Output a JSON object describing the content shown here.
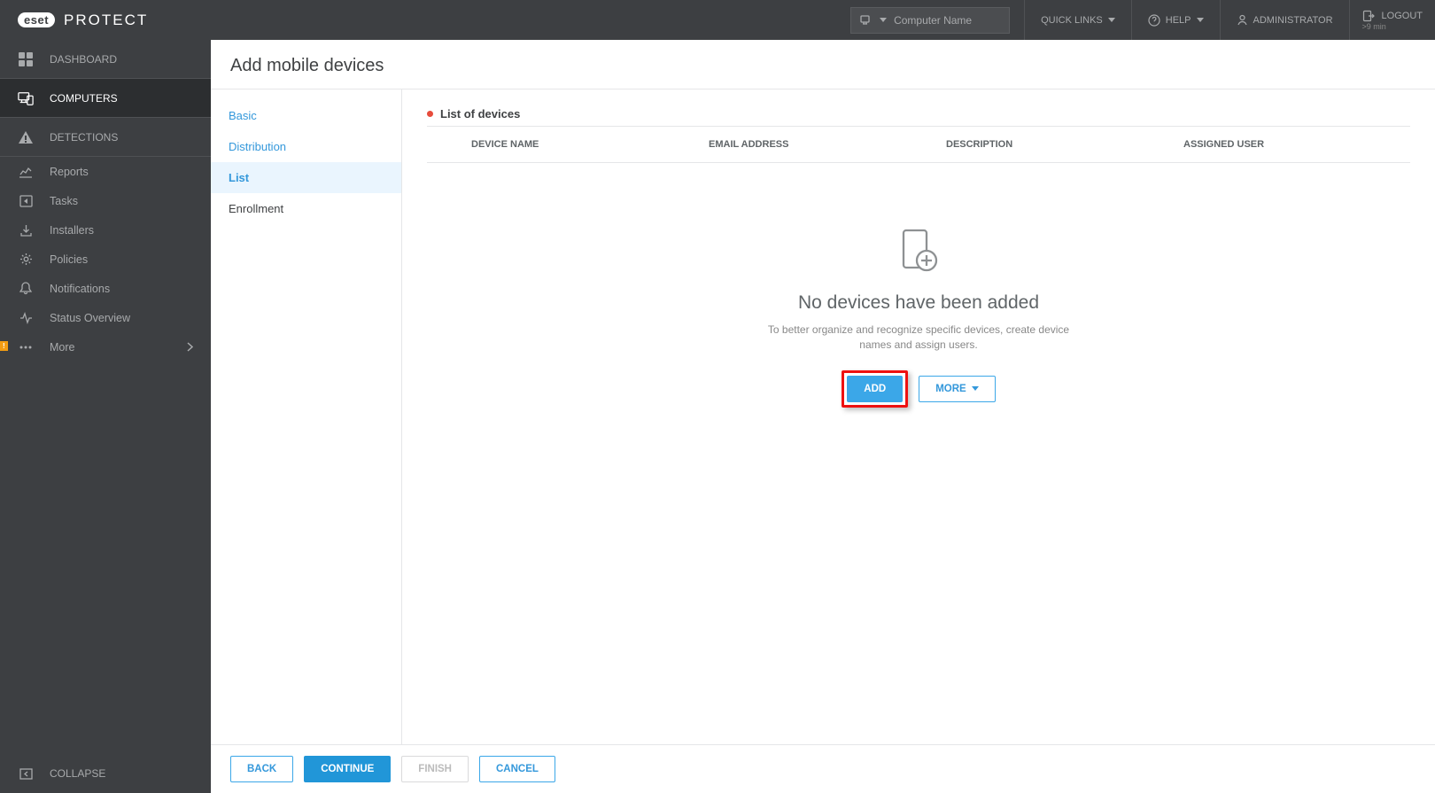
{
  "brand": {
    "logo": "eset",
    "product": "PROTECT"
  },
  "header": {
    "search_placeholder": "Computer Name",
    "quick_links": "QUICK LINKS",
    "help": "HELP",
    "administrator": "ADMINISTRATOR",
    "logout": "LOGOUT",
    "logout_sub": ">9 min"
  },
  "sidebar": {
    "dashboard": "DASHBOARD",
    "computers": "COMPUTERS",
    "detections": "DETECTIONS",
    "reports": "Reports",
    "tasks": "Tasks",
    "installers": "Installers",
    "policies": "Policies",
    "notifications": "Notifications",
    "status_overview": "Status Overview",
    "more": "More",
    "collapse": "COLLAPSE",
    "badge": "!"
  },
  "page": {
    "title": "Add mobile devices"
  },
  "steps": {
    "basic": "Basic",
    "distribution": "Distribution",
    "list": "List",
    "enrollment": "Enrollment"
  },
  "table": {
    "heading": "List of devices",
    "cols": {
      "device_name": "DEVICE NAME",
      "email": "EMAIL ADDRESS",
      "description": "DESCRIPTION",
      "assigned_user": "ASSIGNED USER"
    },
    "rows": []
  },
  "empty": {
    "title": "No devices have been added",
    "desc": "To better organize and recognize specific devices, create device names and assign users.",
    "add": "ADD",
    "more": "MORE"
  },
  "footer": {
    "back": "BACK",
    "continue": "CONTINUE",
    "finish": "FINISH",
    "cancel": "CANCEL"
  }
}
